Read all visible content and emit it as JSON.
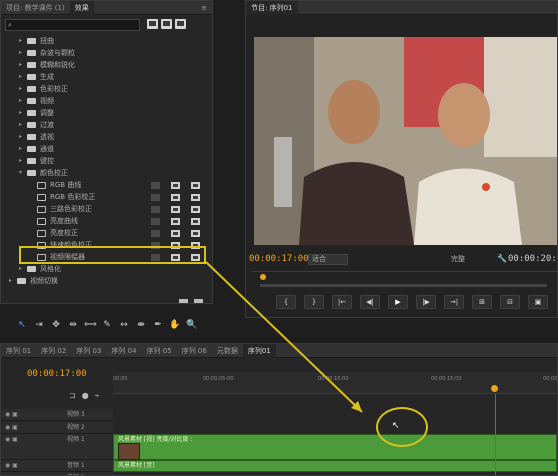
{
  "effects_panel": {
    "tabs": [
      "项目: 教学课件 (1)",
      "效果",
      "≡"
    ],
    "search_value": "",
    "items": [
      {
        "label": "扭曲",
        "indent": 1,
        "type": "folder"
      },
      {
        "label": "杂波与颗粒",
        "indent": 1,
        "type": "folder"
      },
      {
        "label": "模糊和锐化",
        "indent": 1,
        "type": "folder"
      },
      {
        "label": "生成",
        "indent": 1,
        "type": "folder"
      },
      {
        "label": "色彩校正",
        "indent": 1,
        "type": "folder"
      },
      {
        "label": "视频",
        "indent": 1,
        "type": "folder"
      },
      {
        "label": "调整",
        "indent": 1,
        "type": "folder"
      },
      {
        "label": "过渡",
        "indent": 1,
        "type": "folder"
      },
      {
        "label": "透视",
        "indent": 1,
        "type": "folder"
      },
      {
        "label": "通道",
        "indent": 1,
        "type": "folder"
      },
      {
        "label": "键控",
        "indent": 1,
        "type": "folder"
      },
      {
        "label": "颜色校正",
        "indent": 1,
        "type": "folder-open"
      },
      {
        "label": "RGB 曲线",
        "indent": 2,
        "type": "effect"
      },
      {
        "label": "RGB 色彩校正",
        "indent": 2,
        "type": "effect"
      },
      {
        "label": "三路色彩校正",
        "indent": 2,
        "type": "effect"
      },
      {
        "label": "亮度曲线",
        "indent": 2,
        "type": "effect"
      },
      {
        "label": "亮度校正",
        "indent": 2,
        "type": "effect"
      },
      {
        "label": "快速颜色校正",
        "indent": 2,
        "type": "effect"
      },
      {
        "label": "视频限幅器",
        "indent": 2,
        "type": "effect"
      },
      {
        "label": "风格化",
        "indent": 1,
        "type": "folder"
      },
      {
        "label": "视频切换",
        "indent": 0,
        "type": "folder"
      }
    ]
  },
  "program_monitor": {
    "tab": "节目: 序列01",
    "timecode_left": "00:00:17:00",
    "fit": "适合",
    "quality": "完整",
    "timecode_right": "00:00:20:",
    "transport": [
      "{",
      "}",
      "|←",
      "◀|",
      "▶",
      "|▶",
      "→|",
      "⊞",
      "⊟",
      "▣"
    ]
  },
  "tools": [
    "↖",
    "⇥",
    "✥",
    "⇹",
    "⟺",
    "✎",
    "↔",
    "⇼",
    "✒",
    "✋",
    "🔍"
  ],
  "timeline": {
    "tabs": [
      "序列 01",
      "序列 02",
      "序列 03",
      "序列 04",
      "序列 05",
      "序列 06",
      "元数据",
      "序列01"
    ],
    "timecode": "00:00:17:00",
    "ruler_ticks": [
      "00:00",
      "00:00:05:00",
      "00:00:10:00",
      "00:00:15:00",
      "00:00:"
    ],
    "tracks": [
      {
        "head": "视频 3",
        "label": ""
      },
      {
        "head": "视频 2",
        "label": ""
      },
      {
        "head": "视频 1",
        "label": "风景素材 [视] 亮度/对比度 :"
      },
      {
        "head": "音频 1",
        "label": "风景素材 [音]"
      },
      {
        "head": "音频 2",
        "label": ""
      }
    ]
  },
  "colors": {
    "accent": "#f0a21c",
    "highlight": "#d8c21a",
    "clip": "#4c9a3a"
  }
}
